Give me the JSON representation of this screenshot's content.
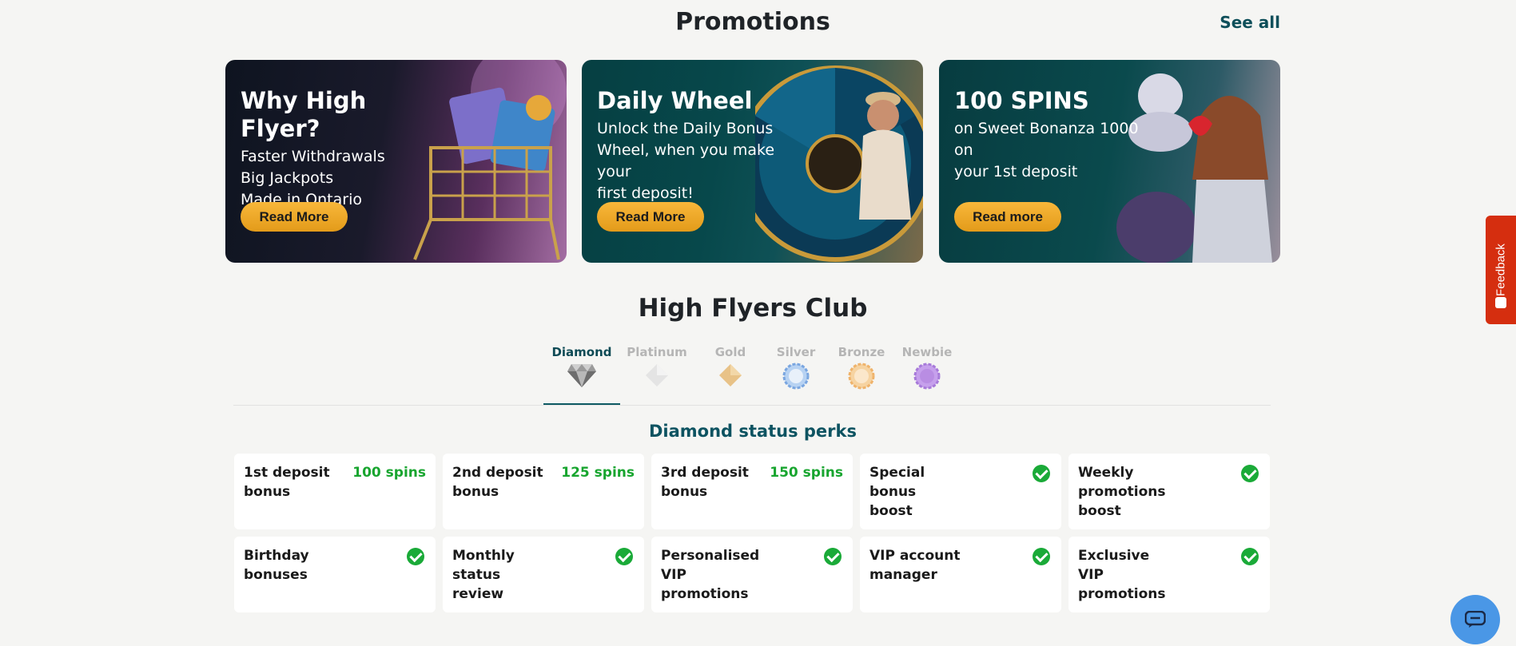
{
  "promotions": {
    "title": "Promotions",
    "see_all": "See all",
    "cards": [
      {
        "title": "Why High Flyer?",
        "lines": [
          "Faster Withdrawals",
          "Big Jackpots",
          "Made in Ontario"
        ],
        "button": "Read More"
      },
      {
        "title": "Daily Wheel",
        "lines": [
          "Unlock the Daily Bonus",
          "Wheel, when you make your",
          "first deposit!"
        ],
        "button": "Read More"
      },
      {
        "title": "100 SPINS",
        "lines": [
          "on Sweet Bonanza 1000 on",
          "your 1st deposit"
        ],
        "button": "Read more"
      }
    ]
  },
  "club": {
    "title": "High Flyers Club",
    "tiers": [
      {
        "label": "Diamond",
        "active": true,
        "color": "#8c8c8c"
      },
      {
        "label": "Platinum",
        "active": false,
        "color": "#d8d8d8"
      },
      {
        "label": "Gold",
        "active": false,
        "color": "#e3b873"
      },
      {
        "label": "Silver",
        "active": false,
        "color": "#8fb8e6"
      },
      {
        "label": "Bronze",
        "active": false,
        "color": "#f1c27d"
      },
      {
        "label": "Newbie",
        "active": false,
        "color": "#b98de3"
      }
    ],
    "perks_title": "Diamond status perks",
    "perks": [
      {
        "name": "1st deposit bonus",
        "value": "100 spins"
      },
      {
        "name": "2nd deposit bonus",
        "value": "125 spins"
      },
      {
        "name": "3rd deposit bonus",
        "value": "150 spins"
      },
      {
        "name": "Special bonus boost",
        "value": "check"
      },
      {
        "name": "Weekly promotions boost",
        "value": "check"
      },
      {
        "name": "Birthday bonuses",
        "value": "check"
      },
      {
        "name": "Monthly status review",
        "value": "check"
      },
      {
        "name": "Personalised VIP promotions",
        "value": "check"
      },
      {
        "name": "VIP account manager",
        "value": "check"
      },
      {
        "name": "Exclusive VIP promotions",
        "value": "check"
      }
    ]
  },
  "feedback": {
    "label": "Feedback"
  },
  "colors": {
    "accent": "#0e4f5a",
    "button": "#f0a92a",
    "check": "#1aaa38",
    "feedback": "#d52e0f",
    "chat": "#4a97e6"
  }
}
